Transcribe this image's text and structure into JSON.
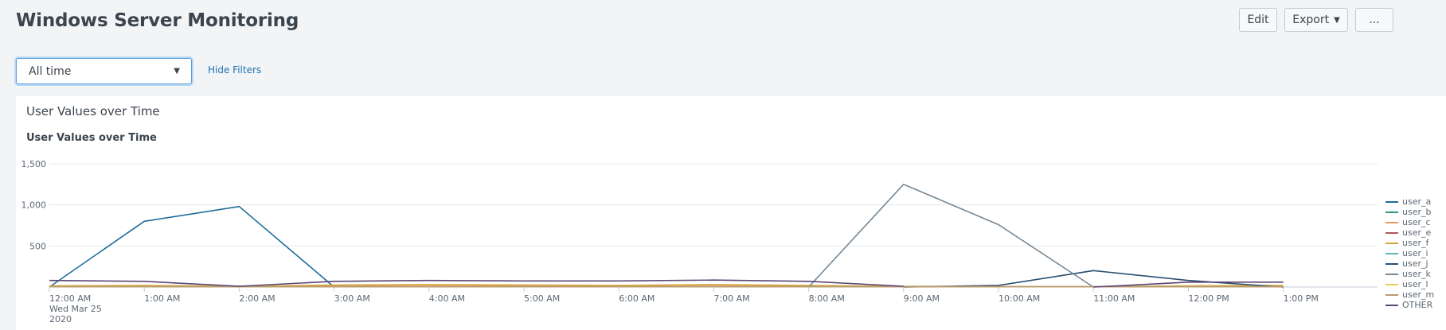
{
  "header": {
    "title": "Windows Server Monitoring",
    "edit_label": "Edit",
    "export_label": "Export",
    "more_label": "..."
  },
  "filters": {
    "time_range": "All time",
    "hide_filters_label": "Hide Filters"
  },
  "panel": {
    "title": "User Values over Time",
    "viz_title": "User Values over Time"
  },
  "chart_data": {
    "type": "line",
    "title": "User Values over Time",
    "x": [
      "12:00 AM",
      "1:00 AM",
      "2:00 AM",
      "3:00 AM",
      "4:00 AM",
      "5:00 AM",
      "6:00 AM",
      "7:00 AM",
      "8:00 AM",
      "9:00 AM",
      "10:00 AM",
      "11:00 AM",
      "12:00 PM",
      "1:00 PM"
    ],
    "x_first_tick_sublabel": [
      "Wed Mar 25",
      "2020"
    ],
    "ylim": [
      0,
      1500
    ],
    "yticks": [
      "500",
      "1,000",
      "1,500"
    ],
    "ytick_values": [
      500,
      1000,
      1500
    ],
    "grid": true,
    "legend_position": "right",
    "series": [
      {
        "name": "user_a",
        "color": "#1e6e9b",
        "values": [
          0,
          800,
          980,
          0,
          null,
          null,
          null,
          null,
          null,
          null,
          null,
          null,
          null,
          null
        ]
      },
      {
        "name": "user_b",
        "color": "#2a9a7e",
        "values": [
          5,
          5,
          5,
          5,
          5,
          5,
          5,
          5,
          5,
          5,
          5,
          5,
          5,
          5
        ]
      },
      {
        "name": "user_c",
        "color": "#ec9960",
        "values": [
          10,
          15,
          5,
          20,
          25,
          20,
          20,
          25,
          15,
          5,
          5,
          5,
          10,
          15
        ]
      },
      {
        "name": "user_e",
        "color": "#af575a",
        "values": [
          5,
          5,
          5,
          5,
          5,
          5,
          5,
          5,
          5,
          5,
          5,
          5,
          5,
          5
        ]
      },
      {
        "name": "user_f",
        "color": "#d6a53c",
        "values": [
          15,
          20,
          10,
          25,
          30,
          25,
          20,
          30,
          20,
          10,
          5,
          5,
          15,
          20
        ]
      },
      {
        "name": "user_i",
        "color": "#62b3b2",
        "values": [
          5,
          5,
          5,
          5,
          5,
          5,
          5,
          5,
          5,
          5,
          5,
          5,
          5,
          5
        ]
      },
      {
        "name": "user_j",
        "color": "#294e70",
        "values": [
          null,
          null,
          null,
          null,
          null,
          null,
          null,
          null,
          null,
          0,
          20,
          200,
          80,
          0
        ]
      },
      {
        "name": "user_k",
        "color": "#738795",
        "values": [
          null,
          null,
          null,
          null,
          null,
          null,
          null,
          null,
          0,
          1250,
          760,
          0,
          null,
          null
        ]
      },
      {
        "name": "user_l",
        "color": "#edd051",
        "values": [
          5,
          5,
          5,
          5,
          5,
          5,
          5,
          5,
          5,
          5,
          5,
          5,
          5,
          5
        ]
      },
      {
        "name": "user_m",
        "color": "#bd9872",
        "values": [
          5,
          5,
          5,
          5,
          5,
          5,
          5,
          5,
          5,
          5,
          5,
          5,
          5,
          5
        ]
      },
      {
        "name": "OTHER",
        "color": "#5a4575",
        "values": [
          80,
          70,
          10,
          70,
          80,
          75,
          75,
          85,
          70,
          10,
          null,
          0,
          60,
          60
        ]
      }
    ]
  }
}
